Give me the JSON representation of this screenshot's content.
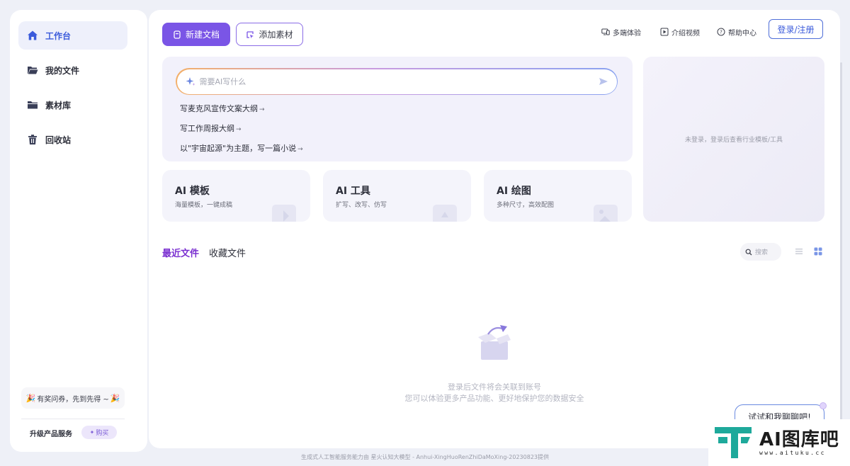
{
  "sidebar": {
    "items": [
      {
        "label": "工作台",
        "icon": "home-icon",
        "active": true
      },
      {
        "label": "我的文件",
        "icon": "folder-open-icon",
        "active": false
      },
      {
        "label": "素材库",
        "icon": "folder-icon",
        "active": false
      },
      {
        "label": "回收站",
        "icon": "trash-icon",
        "active": false
      }
    ],
    "promo_text": "有奖问券，先到先得 ~",
    "upgrade_label": "升级产品服务",
    "buy_label": "购买"
  },
  "toolbar": {
    "new_doc_label": "新建文档",
    "add_material_label": "添加素材",
    "links": [
      {
        "label": "多端体验",
        "icon": "devices-icon"
      },
      {
        "label": "介绍视频",
        "icon": "play-icon"
      },
      {
        "label": "帮助中心",
        "icon": "help-icon"
      }
    ],
    "login_label": "登录/注册"
  },
  "ai_panel": {
    "placeholder": "需要AI写什么",
    "suggestions": [
      "写麦克风宣传文案大纲",
      "写工作周报大纲",
      "以\"宇宙起源\"为主题，写一篇小说"
    ]
  },
  "right_panel": {
    "message": "未登录，登录后查看行业模板/工具"
  },
  "cards": [
    {
      "title": "AI 模板",
      "subtitle": "海量模板，一键成稿"
    },
    {
      "title": "AI 工具",
      "subtitle": "扩写、改写、仿写"
    },
    {
      "title": "AI 绘图",
      "subtitle": "多种尺寸，高效配图"
    }
  ],
  "file_tabs": {
    "recent": "最近文件",
    "favorites": "收藏文件"
  },
  "search": {
    "placeholder": "搜索"
  },
  "empty_state": {
    "line1": "登录后文件将会关联到账号",
    "line2": "您可以体验更多产品功能、更好地保护您的数据安全"
  },
  "chat_bubble": "试试和我聊聊吧!",
  "footer": "生成式人工智能服务能力由 星火认知大模型 - Anhui-XingHuoRenZhiDaMoXing-20230823提供",
  "watermark": {
    "title": "AI图库吧",
    "url": "www.aituku.cc"
  },
  "colors": {
    "accent": "#7a55e6",
    "active_nav": "#3b5bdb",
    "active_tab": "#7a2fd0"
  }
}
